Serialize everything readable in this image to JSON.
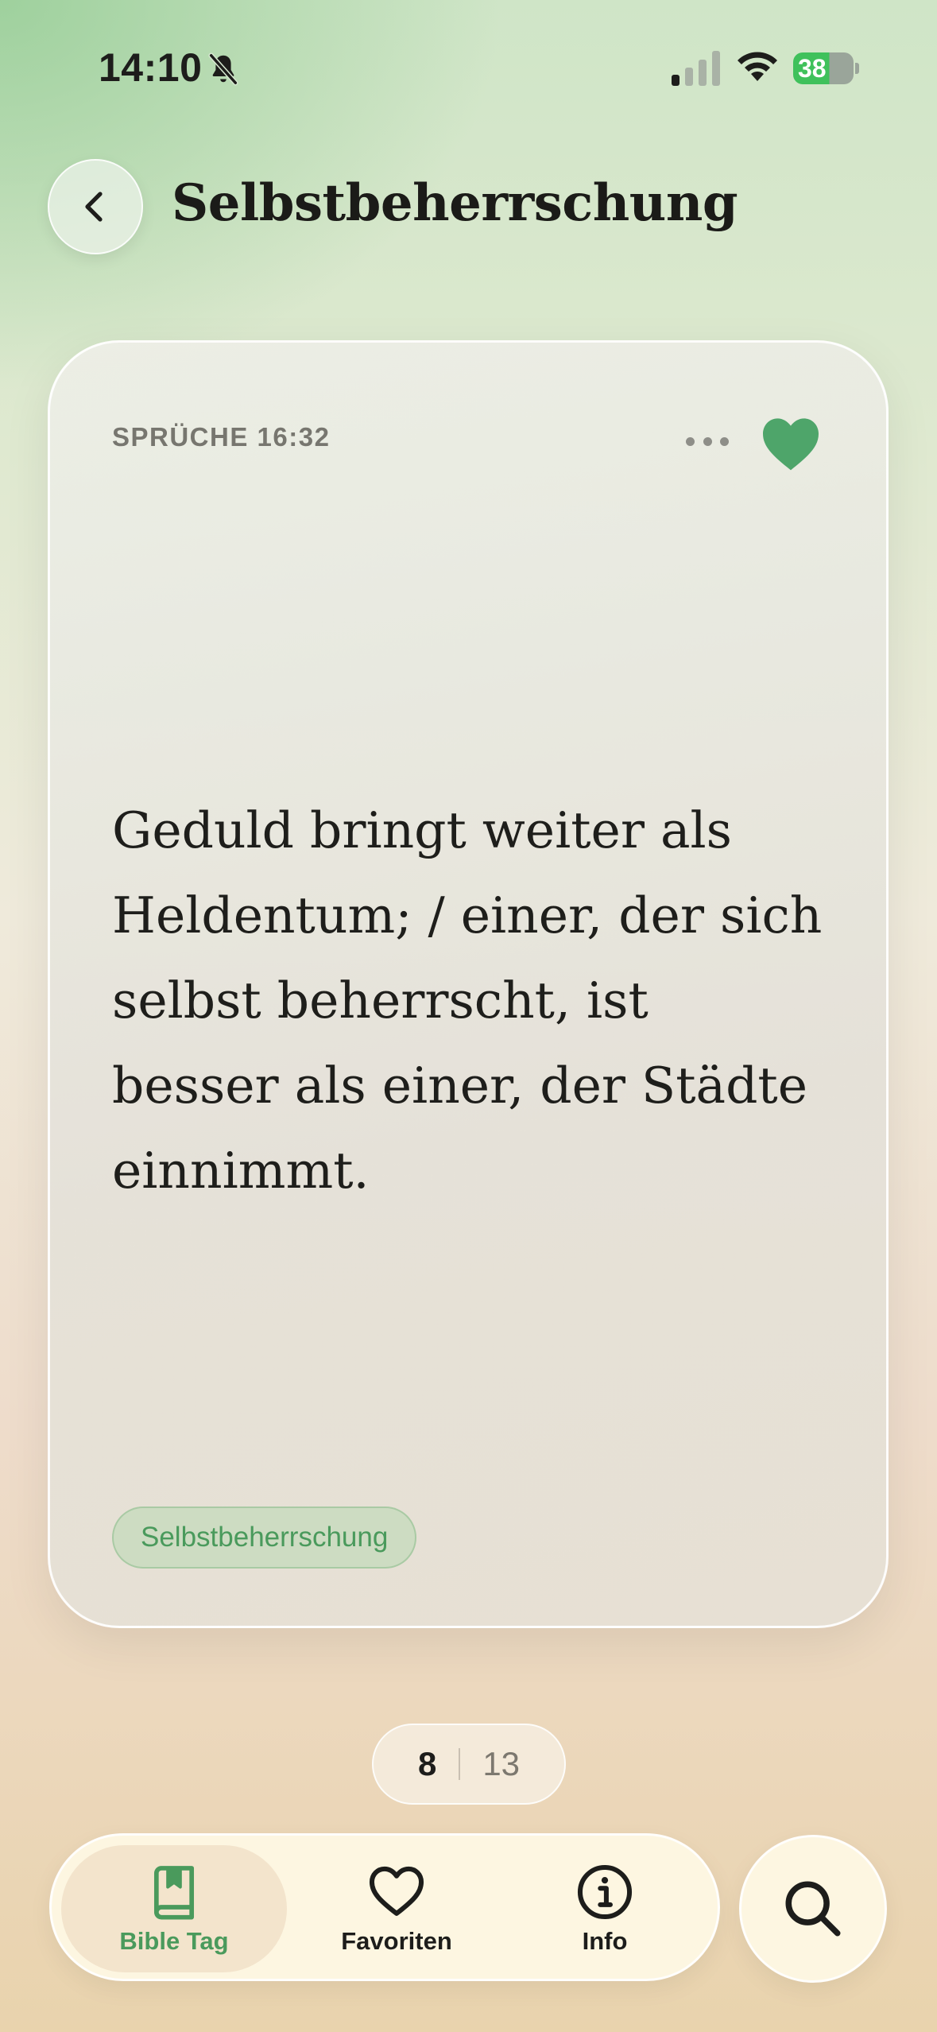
{
  "status_bar": {
    "time": "14:10",
    "battery_level": "38"
  },
  "header": {
    "title": "Selbstbeherrschung"
  },
  "verse_card": {
    "reference": "SPRÜCHE 16:32",
    "text": "Geduld bringt weiter als Heldentum; / einer, der sich selbst beherrscht, ist besser als einer, der Städte einnimmt.",
    "tag": "Selbstbeherrschung",
    "favorited": true
  },
  "pager": {
    "current": "8",
    "total": "13"
  },
  "tab_bar": {
    "tabs": [
      {
        "label": "Bible Tag",
        "icon": "bookmark-book-icon",
        "active": true
      },
      {
        "label": "Favoriten",
        "icon": "heart-icon",
        "active": false
      },
      {
        "label": "Info",
        "icon": "info-icon",
        "active": false
      }
    ],
    "search_icon": "search-icon"
  },
  "colors": {
    "accent_green": "#4a9a5c",
    "heart_green": "#4ea56a",
    "text_dark": "#1d1d1b"
  }
}
